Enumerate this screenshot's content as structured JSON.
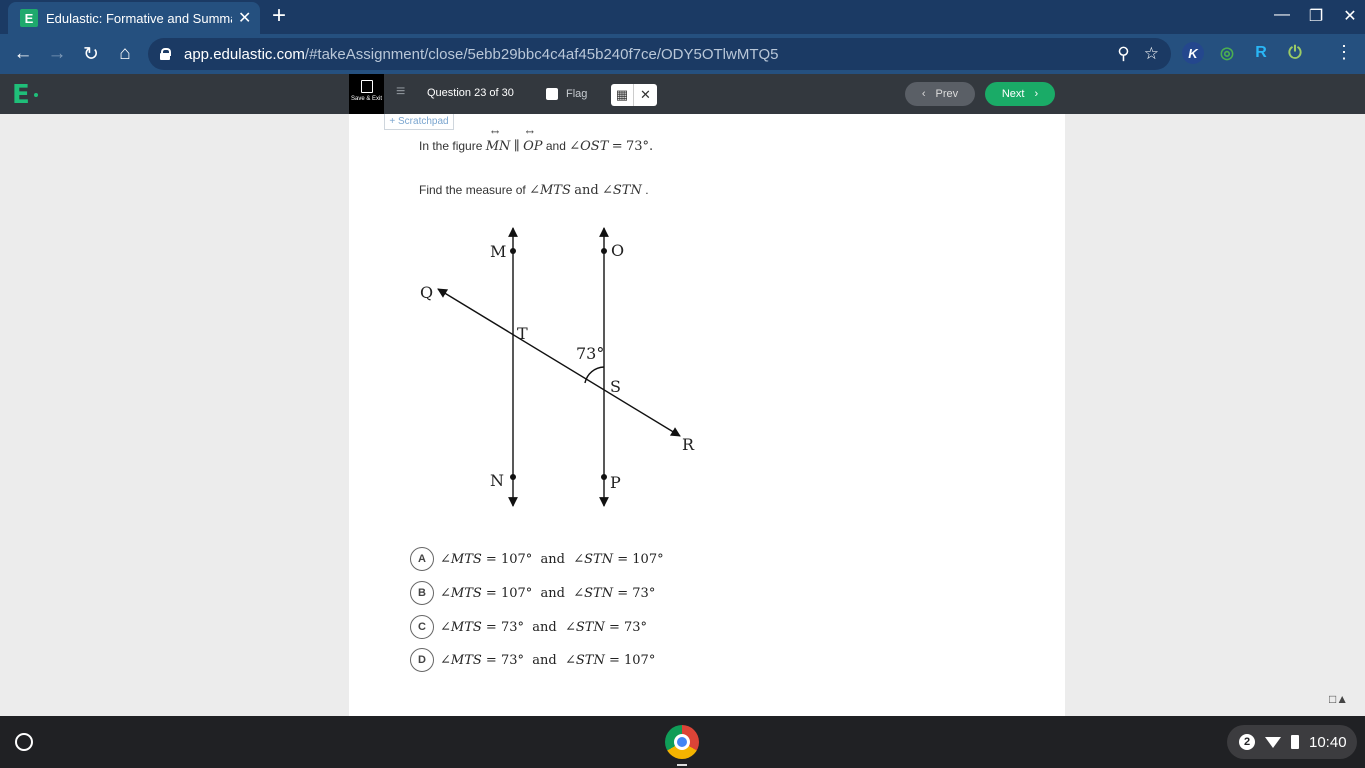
{
  "browser": {
    "tab_title": "Edulastic: Formative and Summa",
    "tab_favicon": "E",
    "url_host": "app.edulastic.com",
    "url_path": "/#takeAssignment/close/5ebb29bbc4c4af45b240f7ce/ODY5OTlwMTQ5",
    "window_controls": [
      "minimize-icon",
      "restore-icon",
      "close-icon"
    ],
    "extensions": [
      "K",
      "◎",
      "R",
      "⏻"
    ]
  },
  "appbar": {
    "save_exit_label": "Save & Exit",
    "question_counter": "Question 23 of 30",
    "flag_label": "Flag",
    "prev_label": "Prev",
    "next_label": "Next",
    "accent_color": "#1aab67"
  },
  "question": {
    "scratchpad_label": "Scratchpad",
    "stem_line1": {
      "prefix": "In the figure",
      "line1": "MN",
      "parallel": "∥",
      "line2": "OP",
      "and": "and",
      "angle": "∠OST",
      "equals": "=",
      "value": "73°."
    },
    "stem_line2": {
      "prefix": "Find the measure of",
      "angle1": "∠MTS",
      "and": "and",
      "angle2": "∠STN",
      "suffix": "."
    },
    "figure": {
      "labels": {
        "M": "M",
        "O": "O",
        "Q": "Q",
        "T": "T",
        "S": "S",
        "R": "R",
        "N": "N",
        "P": "P",
        "angle": "73°"
      }
    },
    "choices": [
      {
        "letter": "A",
        "a1": "∠MTS",
        "v1": "= 107°",
        "and": "and",
        "a2": "∠STN",
        "v2": "= 107°"
      },
      {
        "letter": "B",
        "a1": "∠MTS",
        "v1": "= 107°",
        "and": "and",
        "a2": "∠STN",
        "v2": "= 73°"
      },
      {
        "letter": "C",
        "a1": "∠MTS",
        "v1": "= 73°",
        "and": "and",
        "a2": "∠STN",
        "v2": "= 73°"
      },
      {
        "letter": "D",
        "a1": "∠MTS",
        "v1": "= 73°",
        "and": "and",
        "a2": "∠STN",
        "v2": "= 107°"
      }
    ]
  },
  "shelf": {
    "notification_count": "2",
    "time": "10:40"
  }
}
